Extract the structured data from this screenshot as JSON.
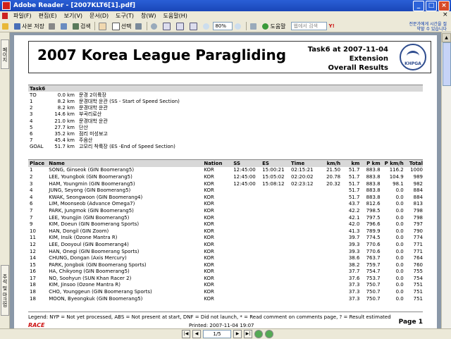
{
  "window": {
    "title": "Adobe Reader - [2007KLT6[1].pdf]"
  },
  "menu": [
    "파일(F)",
    "편집(E)",
    "보기(V)",
    "문서(D)",
    "도구(T)",
    "창(W)",
    "도움말(H)"
  ],
  "toolbar": {
    "save_copy": "사본 저장",
    "search": "검색",
    "select": "선택",
    "zoom": "80%",
    "help": "도움말",
    "search_placeholder": "웹에서 검색",
    "promo": "전문가에게 시간을 절약할 수 있습니다"
  },
  "sidebar": {
    "tab_pages": "페이지",
    "tab_comments": "주석 및 마크업"
  },
  "header": {
    "title": "2007 Korea League Paragliding",
    "task_line": "Task6 at 2007-11-04",
    "type_line": "Extension",
    "results_line": "Overall Results",
    "logo_text": "KHPGA"
  },
  "route": {
    "header": "Task6",
    "rows": [
      {
        "tp": "TO",
        "dist": "0.0 km",
        "desc": "문경 2이륙장"
      },
      {
        "tp": "1",
        "dist": "8.2 km",
        "desc": "문경대학 운관 (SS - Start of Speed Section)"
      },
      {
        "tp": "2",
        "dist": "8.2 km",
        "desc": "문경대학 운관"
      },
      {
        "tp": "3",
        "dist": "14.6 km",
        "desc": "부곡리로산"
      },
      {
        "tp": "4",
        "dist": "21.0 km",
        "desc": "문경대학 운관"
      },
      {
        "tp": "5",
        "dist": "27.7 km",
        "desc": "단산"
      },
      {
        "tp": "6",
        "dist": "35.2 km",
        "desc": "점리 미성보고"
      },
      {
        "tp": "7",
        "dist": "45.4 km",
        "desc": "주음산"
      },
      {
        "tp": "GOAL",
        "dist": "51.7 km",
        "desc": "고모리 착륙장 (ES -End of Speed Section)"
      }
    ]
  },
  "results": {
    "columns": [
      "Place",
      "Name",
      "Nation",
      "SS",
      "ES",
      "Time",
      "km/h",
      "km",
      "P km",
      "P km/h",
      "Total"
    ],
    "rows": [
      [
        "1",
        "SONG, Ginseok (GIN Boomerang5)",
        "KOR",
        "12:45:00",
        "15:00:21",
        "02:15:21",
        "21.50",
        "51.7",
        "883.8",
        "116.2",
        "1000"
      ],
      [
        "2",
        "LEE, Youngbok (GIN Boomerang5)",
        "KOR",
        "12:45:00",
        "15:05:02",
        "02:20:02",
        "20.78",
        "51.7",
        "883.8",
        "104.9",
        "989"
      ],
      [
        "3",
        "HAM, Youngmin (GIN Boomerang5)",
        "KOR",
        "12:45:00",
        "15:08:12",
        "02:23:12",
        "20.32",
        "51.7",
        "883.8",
        "98.1",
        "982"
      ],
      [
        "4",
        "JUNG, Seyong (GIN Boomerang5)",
        "KOR",
        "",
        "",
        "",
        "",
        "51.7",
        "883.8",
        "0.0",
        "884"
      ],
      [
        "4",
        "KWAK, Seongwoon (GIN Boomerang4)",
        "KOR",
        "",
        "",
        "",
        "",
        "51.7",
        "883.8",
        "0.0",
        "884"
      ],
      [
        "6",
        "LIM, Moonseob (Advance Omega7)",
        "KOR",
        "",
        "",
        "",
        "",
        "43.7",
        "812.6",
        "0.0",
        "813"
      ],
      [
        "7",
        "PARK, Jungmok (GIN Boomerang5)",
        "KOR",
        "",
        "",
        "",
        "",
        "42.2",
        "798.5",
        "0.0",
        "798"
      ],
      [
        "7",
        "LEE, Youngjin (GIN Boomerang5)",
        "KOR",
        "",
        "",
        "",
        "",
        "42.1",
        "797.5",
        "0.0",
        "798"
      ],
      [
        "9",
        "KIM, Doeun (GIN Boomerang Sports)",
        "KOR",
        "",
        "",
        "",
        "",
        "42.0",
        "796.6",
        "0.0",
        "797"
      ],
      [
        "10",
        "HAN, Dongil (GIN Zoom)",
        "KOR",
        "",
        "",
        "",
        "",
        "41.3",
        "789.9",
        "0.0",
        "790"
      ],
      [
        "11",
        "KIM, Insik (Ozone Mantra R)",
        "KOR",
        "",
        "",
        "",
        "",
        "39.7",
        "774.5",
        "0.0",
        "774"
      ],
      [
        "12",
        "LEE, Dooyoul (GIN Boomerang4)",
        "KOR",
        "",
        "",
        "",
        "",
        "39.3",
        "770.6",
        "0.0",
        "771"
      ],
      [
        "12",
        "HAN, Onegi (GIN Boomerang Sports)",
        "KOR",
        "",
        "",
        "",
        "",
        "39.3",
        "770.6",
        "0.0",
        "771"
      ],
      [
        "14",
        "CHUNG, Dongan (Axis Mercury)",
        "KOR",
        "",
        "",
        "",
        "",
        "38.6",
        "763.7",
        "0.0",
        "764"
      ],
      [
        "15",
        "PARK, Jongbok (GIN Boomerang Sports)",
        "KOR",
        "",
        "",
        "",
        "",
        "38.2",
        "759.7",
        "0.0",
        "760"
      ],
      [
        "16",
        "HA, Chikyong (GIN Boomerang5)",
        "KOR",
        "",
        "",
        "",
        "",
        "37.7",
        "754.7",
        "0.0",
        "755"
      ],
      [
        "17",
        "NO, Soohyun (SUN Khan Racer 2)",
        "KOR",
        "",
        "",
        "",
        "",
        "37.6",
        "753.7",
        "0.0",
        "754"
      ],
      [
        "18",
        "KIM, Jinsoo (Ozone Mantra R)",
        "KOR",
        "",
        "",
        "",
        "",
        "37.3",
        "750.7",
        "0.0",
        "751"
      ],
      [
        "18",
        "CHO, Younggeun (GIN Boomerang Sports)",
        "KOR",
        "",
        "",
        "",
        "",
        "37.3",
        "750.7",
        "0.0",
        "751"
      ],
      [
        "18",
        "MOON, Byeongkuk (GIN Boomerang5)",
        "KOR",
        "",
        "",
        "",
        "",
        "37.3",
        "750.7",
        "0.0",
        "751"
      ]
    ]
  },
  "legend": "Legend: NYP = Not yet processed, ABS = Not present at start, DNF = Did not launch, * = Read comment on comments page, ? = Result estimated",
  "footer": {
    "brand": "RACE",
    "printed": "Printed: 2007-11-04 19:07",
    "page": "Page 1"
  },
  "status": {
    "page_display": "1/5"
  }
}
